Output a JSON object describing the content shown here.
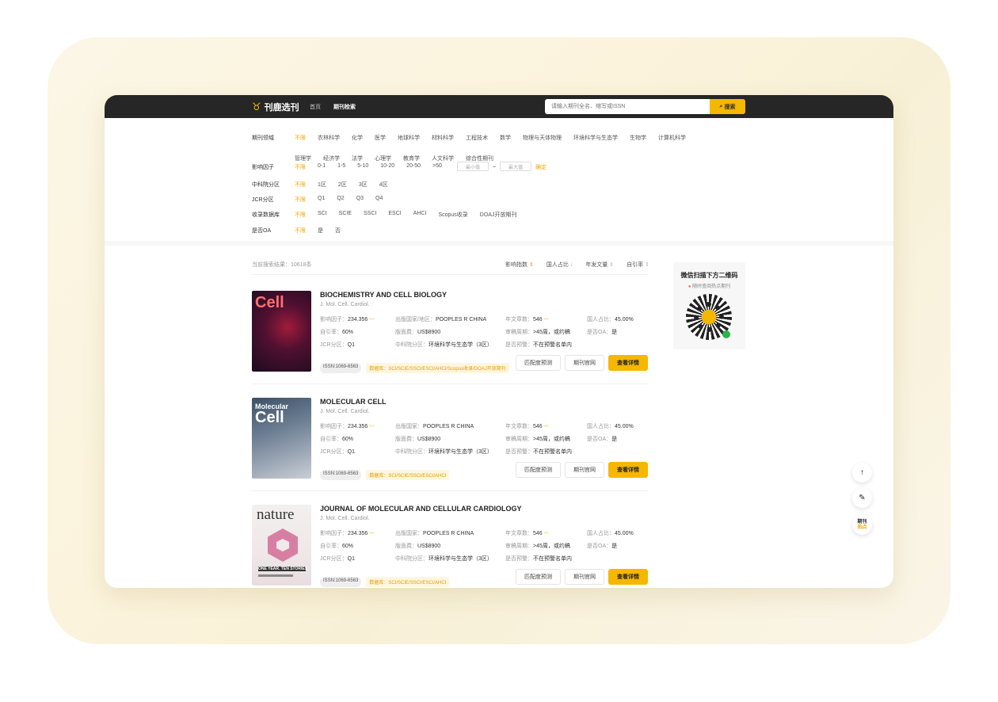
{
  "header": {
    "logo_text": "刊鹿选刊",
    "nav": [
      "首页",
      "期刊检索"
    ],
    "search_placeholder": "请输入期刊全名、缩写或ISSN",
    "search_button": "搜索"
  },
  "filters": {
    "field": {
      "label": "期刊领域",
      "options": [
        "不限",
        "农林科学",
        "化学",
        "医学",
        "地球科学",
        "材料科学",
        "工程技术",
        "数学",
        "物理与天体物理",
        "环境科学与生态学",
        "生物学",
        "计算机科学",
        "管理学",
        "经济学",
        "法学",
        "心理学",
        "教育学",
        "人文科学",
        "综合性期刊"
      ]
    },
    "impact": {
      "label": "影响因子",
      "options": [
        "不限",
        "0-1",
        "1-5",
        "5-10",
        "10-20",
        "20-50",
        ">50"
      ],
      "min_placeholder": "最小值",
      "tilde": "~",
      "max_placeholder": "最大值",
      "confirm": "确定"
    },
    "cas": {
      "label": "中科院分区",
      "options": [
        "不限",
        "1区",
        "2区",
        "3区",
        "4区"
      ]
    },
    "jcr": {
      "label": "JCR分区",
      "options": [
        "不限",
        "Q1",
        "Q2",
        "Q3",
        "Q4"
      ]
    },
    "db": {
      "label": "收录数据库",
      "options": [
        "不限",
        "SCI",
        "SCIE",
        "SSCI",
        "ESCI",
        "AHCI",
        "Scopus收录",
        "DOAJ开放期刊"
      ]
    },
    "oa": {
      "label": "是否OA",
      "options": [
        "不限",
        "是",
        "否"
      ]
    }
  },
  "results": {
    "count_text": "当前搜索结果：10618条",
    "sorts": [
      {
        "label": "影响指数",
        "arrow": "⇕"
      },
      {
        "label": "国人占比",
        "arrow": "↓"
      },
      {
        "label": "年发文量",
        "arrow": "⇕"
      },
      {
        "label": "自引率",
        "arrow": "⇕"
      }
    ]
  },
  "journals": [
    {
      "cover": "Cell",
      "title": "BIOCHEMISTRY AND CELL BIOLOGY",
      "abbr": "J. Mol. Cell. Cardiol.",
      "impact_label": "影响因子：",
      "impact": "234.356",
      "self_cite_label": "自引率：",
      "self_cite": "60%",
      "jcr_label": "JCR分区：",
      "jcr": "Q1",
      "country_label": "出版国家/地区：",
      "country": "POOPLES R CHINA",
      "fee_label": "版面费：",
      "fee": "US$8900",
      "cas_label": "中科院分区：",
      "cas": "环境科学与生态学（3区）",
      "articles_label": "年文章数：",
      "articles": "546",
      "review_label": "审稿周期：",
      "review": ">45周，或约稿",
      "warn_label": "是否预警：",
      "warn": "不在预警名单内",
      "cn_label": "国人占比：",
      "cn": "45.00%",
      "oa_label": "是否OA：",
      "oa": "是",
      "issn": "ISSN:1069-6563",
      "db": "数据库：SCI/SCIE/SSCI/ESCI/AHCI/Scopus收录/DOAJ开放期刊"
    },
    {
      "cover_a": "Molecular",
      "cover": "Cell",
      "title": "MOLECULAR CELL",
      "abbr": "J. Mol. Cell. Cardiol.",
      "impact_label": "影响因子：",
      "impact": "234.356",
      "self_cite_label": "自引率：",
      "self_cite": "60%",
      "jcr_label": "JCR分区：",
      "jcr": "Q1",
      "country_label": "出版国家：",
      "country": "POOPLES R CHINA",
      "fee_label": "版面费：",
      "fee": "US$8900",
      "cas_label": "中科院分区：",
      "cas": "环境科学与生态学（3区）",
      "articles_label": "年文章数：",
      "articles": "546",
      "review_label": "审稿周期：",
      "review": ">45周，或约稿",
      "warn_label": "是否预警：",
      "warn": "不在预警名单内",
      "cn_label": "国人占比：",
      "cn": "45.00%",
      "oa_label": "是否OA：",
      "oa": "是",
      "issn": "ISSN:1069-6563",
      "db": "数据库：SCI/SCIE/SSCI/ESCI/AHCI"
    },
    {
      "cover": "nature",
      "cover_sub": "ONE YEAR. TEN STORIES.",
      "title": "JOURNAL OF MOLECULAR AND CELLULAR CARDIOLOGY",
      "abbr": "J. Mol. Cell. Cardiol.",
      "impact_label": "影响因子：",
      "impact": "234.356",
      "self_cite_label": "自引率：",
      "self_cite": "60%",
      "jcr_label": "JCR分区：",
      "jcr": "Q1",
      "country_label": "出版国家：",
      "country": "POOPLES R CHINA",
      "fee_label": "版面费：",
      "fee": "US$8900",
      "cas_label": "中科院分区：",
      "cas": "环境科学与生态学（3区）",
      "articles_label": "年文章数：",
      "articles": "546",
      "review_label": "审稿周期：",
      "review": ">45周，或约稿",
      "warn_label": "是否预警：",
      "warn": "不在预警名单内",
      "cn_label": "国人占比：",
      "cn": "45.00%",
      "oa_label": "是否OA：",
      "oa": "是",
      "issn": "ISSN:1069-6563",
      "db": "数据库：SCI/SCIE/SSCI/ESCI/AHCI"
    }
  ],
  "buttons": {
    "match": "匹配度预测",
    "site": "期刊官网",
    "detail": "查看详情"
  },
  "qr": {
    "title": "微信扫描下方二维码",
    "sub": "随时查阅热点期刊"
  },
  "floats": {
    "top": "↑",
    "edit": "✎",
    "hot_a": "期刊",
    "hot_b": "热点"
  },
  "colors": {
    "accent": "#f5b700",
    "dark": "#262626"
  }
}
